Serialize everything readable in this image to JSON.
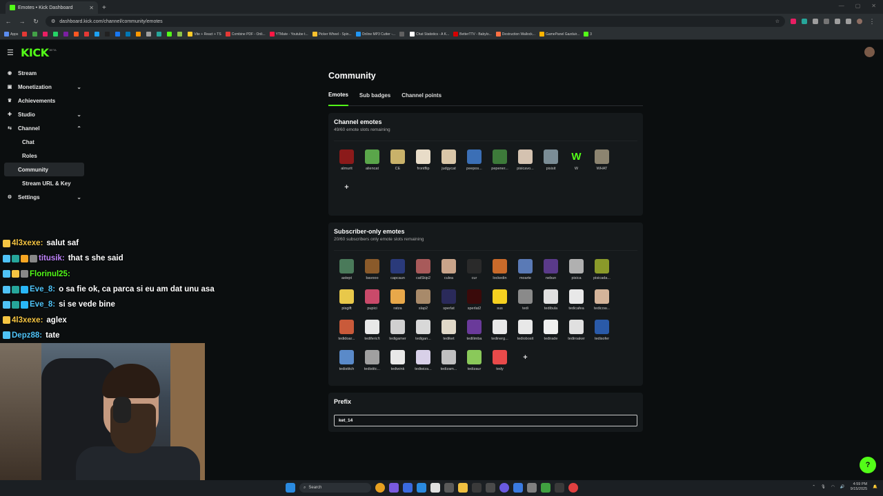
{
  "browser": {
    "tab_title": "Emotes • Kick Dashboard",
    "url": "dashboard.kick.com/channel/community/emotes",
    "bookmarks": [
      {
        "label": "Apps",
        "color": "#5b8def"
      },
      {
        "label": "",
        "color": "#e53935"
      },
      {
        "label": "",
        "color": "#43a047"
      },
      {
        "label": "",
        "color": "#e91e63"
      },
      {
        "label": "",
        "color": "#25d366"
      },
      {
        "label": "",
        "color": "#7b1fa2"
      },
      {
        "label": "",
        "color": "#ff5722"
      },
      {
        "label": "",
        "color": "#e53935"
      },
      {
        "label": "",
        "color": "#1da1f2"
      },
      {
        "label": "",
        "color": "#212121"
      },
      {
        "label": "",
        "color": "#1877f2"
      },
      {
        "label": "",
        "color": "#0077b5"
      },
      {
        "label": "",
        "color": "#ff9800"
      },
      {
        "label": "",
        "color": "#9e9e9e"
      },
      {
        "label": "",
        "color": "#26a69a"
      },
      {
        "label": "",
        "color": "#53fc18"
      },
      {
        "label": "",
        "color": "#8bc34a"
      },
      {
        "label": "Vite + React + TS",
        "color": "#ffca28"
      },
      {
        "label": "Combine PDF - Onli...",
        "color": "#e53935"
      },
      {
        "label": "YTMate - Youtube t...",
        "color": "#ff1744"
      },
      {
        "label": "Picker Wheel - Spin...",
        "color": "#fbc02d"
      },
      {
        "label": "Online MP3 Cutter -...",
        "color": "#2196f3"
      },
      {
        "label": "",
        "color": "#616161"
      },
      {
        "label": "Chat Statistics - A K...",
        "color": "#ffffff"
      },
      {
        "label": "BetterTTV - Babylo...",
        "color": "#d50000"
      },
      {
        "label": "Destruction Wallock...",
        "color": "#ff7043"
      },
      {
        "label": "GamePanel Gazduir...",
        "color": "#ffb300"
      },
      {
        "label": "3",
        "color": "#53fc18"
      }
    ]
  },
  "sidebar": {
    "items": [
      {
        "label": "Stream",
        "icon": "stream-icon",
        "glyph": "◉",
        "chevron": ""
      },
      {
        "label": "Monetization",
        "icon": "money-icon",
        "glyph": "▣",
        "chevron": "⌄"
      },
      {
        "label": "Achievements",
        "icon": "trophy-icon",
        "glyph": "♛",
        "chevron": ""
      },
      {
        "label": "Studio",
        "icon": "studio-icon",
        "glyph": "✚",
        "chevron": "⌄"
      },
      {
        "label": "Channel",
        "icon": "channel-icon",
        "glyph": "⇆",
        "chevron": "⌃"
      }
    ],
    "sub_items": [
      {
        "label": "Chat",
        "active": false
      },
      {
        "label": "Roles",
        "active": false
      },
      {
        "label": "Community",
        "active": true
      },
      {
        "label": "Stream URL & Key",
        "active": false
      }
    ],
    "settings": {
      "label": "Settings",
      "glyph": "⚙",
      "chevron": "⌄"
    }
  },
  "chat": [
    {
      "user": "4l3xexe:",
      "user_color": "#f5c542",
      "text": "salut saf",
      "badges": [
        "#f5c542"
      ]
    },
    {
      "user": "titusik:",
      "user_color": "#c084fc",
      "text": "that s    she said",
      "badges": [
        "#4fc3f7",
        "#26a69a",
        "#f5a623",
        "#888888"
      ]
    },
    {
      "user": "Florinul25:",
      "user_color": "#53fc18",
      "text": "",
      "badges": [
        "#4fc3f7",
        "#f5c542",
        "#888888"
      ]
    },
    {
      "user": "Eve_8:",
      "user_color": "#4fc3f7",
      "text": "o sa fie ok, ca parca si eu am dat unu asa",
      "badges": [
        "#4fc3f7",
        "#26a69a",
        "#29b6f6"
      ]
    },
    {
      "user": "Eve_8:",
      "user_color": "#4fc3f7",
      "text": "si se vede bine",
      "badges": [
        "#4fc3f7",
        "#26a69a",
        "#29b6f6"
      ]
    },
    {
      "user": "4l3xexe:",
      "user_color": "#f5c542",
      "text": "aglex",
      "badges": [
        "#f5c542"
      ]
    },
    {
      "user": "Depz88:",
      "user_color": "#4fc3f7",
      "text": "tate",
      "badges": [
        "#4fc3f7"
      ]
    }
  ],
  "main": {
    "title": "Community",
    "tabs": [
      {
        "label": "Emotes",
        "active": true
      },
      {
        "label": "Sub badges",
        "active": false
      },
      {
        "label": "Channel points",
        "active": false
      }
    ],
    "channel_emotes": {
      "title": "Channel emotes",
      "subtitle": "49/60 emote slots remaining",
      "items": [
        {
          "name": "almurit",
          "color": "#8b1a1a",
          "glyph": ""
        },
        {
          "name": "aliencat",
          "color": "#5aa64a",
          "glyph": ""
        },
        {
          "name": "CE",
          "color": "#c9b26a",
          "glyph": ""
        },
        {
          "name": "frontflip",
          "color": "#e8dcc8",
          "glyph": ""
        },
        {
          "name": "judgycat",
          "color": "#d9c6a8",
          "glyph": ""
        },
        {
          "name": "peepos...",
          "color": "#3b6fb6",
          "glyph": ""
        },
        {
          "name": "pepener...",
          "color": "#3d7a3a",
          "glyph": ""
        },
        {
          "name": "pisicavo...",
          "color": "#d4c2b0",
          "glyph": ""
        },
        {
          "name": "pisisit",
          "color": "#7b8d96",
          "glyph": ""
        },
        {
          "name": "W",
          "color": "transparent",
          "glyph": "W"
        },
        {
          "name": "WHAT",
          "color": "#8c8470",
          "glyph": ""
        }
      ]
    },
    "sub_emotes": {
      "title": "Subscriber-only emotes",
      "subtitle": "20/60 subscribers only emote slots remaining",
      "items": [
        {
          "name": "astept",
          "color": "#4a7a5a"
        },
        {
          "name": "bavooo",
          "color": "#8a5a2a"
        },
        {
          "name": "capcaun",
          "color": "#2a3a7a"
        },
        {
          "name": "catSkip2",
          "color": "#a85a5a"
        },
        {
          "name": "culea",
          "color": "#c9a48a"
        },
        {
          "name": "cur",
          "color": "#2a2a2a"
        },
        {
          "name": "lockedin",
          "color": "#c96a2a"
        },
        {
          "name": "moarte",
          "color": "#5a7ab6"
        },
        {
          "name": "nebun",
          "color": "#5a3a8a"
        },
        {
          "name": "pisica",
          "color": "#b0b0b0"
        },
        {
          "name": "pisicada...",
          "color": "#8a9a2a"
        },
        {
          "name": "pisgift",
          "color": "#e8c84a"
        },
        {
          "name": "pupici",
          "color": "#c94a6a"
        },
        {
          "name": "ratza",
          "color": "#e8a84a"
        },
        {
          "name": "slap2",
          "color": "#a88a6a"
        },
        {
          "name": "sperlat",
          "color": "#2a2a5a"
        },
        {
          "name": "sperlat2",
          "color": "#3a0a0a"
        },
        {
          "name": "sus",
          "color": "#f5d020"
        },
        {
          "name": "tedi",
          "color": "#8a8a8a"
        },
        {
          "name": "tedibula",
          "color": "#e0e0e0"
        },
        {
          "name": "tedicafea",
          "color": "#e8e8e8"
        },
        {
          "name": "tedicow...",
          "color": "#d4b49a"
        },
        {
          "name": "tedidoar...",
          "color": "#c95a3a"
        },
        {
          "name": "tediferic!t",
          "color": "#e8e8e8"
        },
        {
          "name": "tedigamer",
          "color": "#d0d0d0"
        },
        {
          "name": "tedigan...",
          "color": "#d8d8d8"
        },
        {
          "name": "tediket",
          "color": "#e0d8c8"
        },
        {
          "name": "tedilimba",
          "color": "#6a3a9a"
        },
        {
          "name": "tedinerg...",
          "color": "#e8e8e8"
        },
        {
          "name": "tediobosit",
          "color": "#e8e8e8"
        },
        {
          "name": "tedirade",
          "color": "#f0f0f0"
        },
        {
          "name": "tediroaker",
          "color": "#e0e0e0"
        },
        {
          "name": "tedisofer",
          "color": "#2a5aa8"
        },
        {
          "name": "tedistitch",
          "color": "#5a8ac9"
        },
        {
          "name": "tedistitc...",
          "color": "#a0a0a0"
        },
        {
          "name": "tediwink",
          "color": "#e8e8e8"
        },
        {
          "name": "tediwiza...",
          "color": "#d8d0e8"
        },
        {
          "name": "tedizam...",
          "color": "#c0c0c0"
        },
        {
          "name": "tedizaur",
          "color": "#8ac95a"
        },
        {
          "name": "tedy",
          "color": "#e84a4a"
        }
      ]
    },
    "prefix": {
      "title": "Prefix",
      "value": "ket_14"
    }
  },
  "taskbar": {
    "search_label": "Search",
    "time": "4:59 PM",
    "date": "9/15/2025"
  },
  "help_fab_glyph": "?"
}
